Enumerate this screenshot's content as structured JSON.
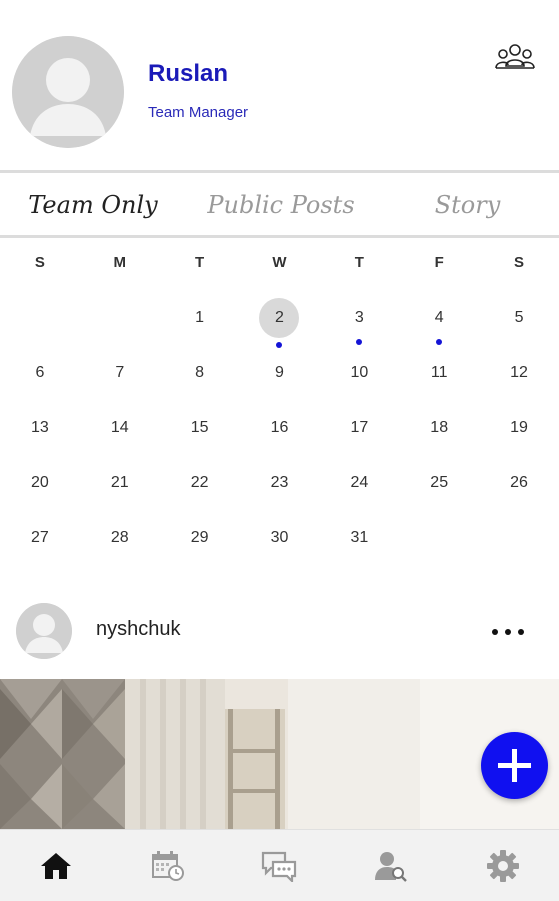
{
  "profile": {
    "name": "Ruslan",
    "role": "Team Manager",
    "team_icon": "team-group-icon"
  },
  "tabs": [
    {
      "label": "Team Only",
      "active": true
    },
    {
      "label": "Public Posts",
      "active": false
    },
    {
      "label": "Story",
      "active": false
    }
  ],
  "calendar": {
    "weekdays": [
      "S",
      "M",
      "T",
      "W",
      "T",
      "F",
      "S"
    ],
    "weeks": [
      [
        "",
        "",
        "1",
        "2",
        "3",
        "4",
        "5"
      ],
      [
        "6",
        "7",
        "8",
        "9",
        "10",
        "11",
        "12"
      ],
      [
        "13",
        "14",
        "15",
        "16",
        "17",
        "18",
        "19"
      ],
      [
        "20",
        "21",
        "22",
        "23",
        "24",
        "25",
        "26"
      ],
      [
        "27",
        "28",
        "29",
        "30",
        "31",
        "",
        ""
      ]
    ],
    "selected_day": "2",
    "event_days": [
      "2",
      "3",
      "4"
    ],
    "accent_color": "#1414d6"
  },
  "post": {
    "username": "nyshchuk",
    "menu_icon": "more-horizontal-icon"
  },
  "fab": {
    "icon": "plus-icon",
    "color": "#1010f0"
  },
  "bottom_nav": [
    {
      "icon": "home-icon",
      "active": true
    },
    {
      "icon": "calendar-clock-icon",
      "active": false
    },
    {
      "icon": "chat-icon",
      "active": false
    },
    {
      "icon": "user-search-icon",
      "active": false
    },
    {
      "icon": "settings-gear-icon",
      "active": false
    }
  ]
}
